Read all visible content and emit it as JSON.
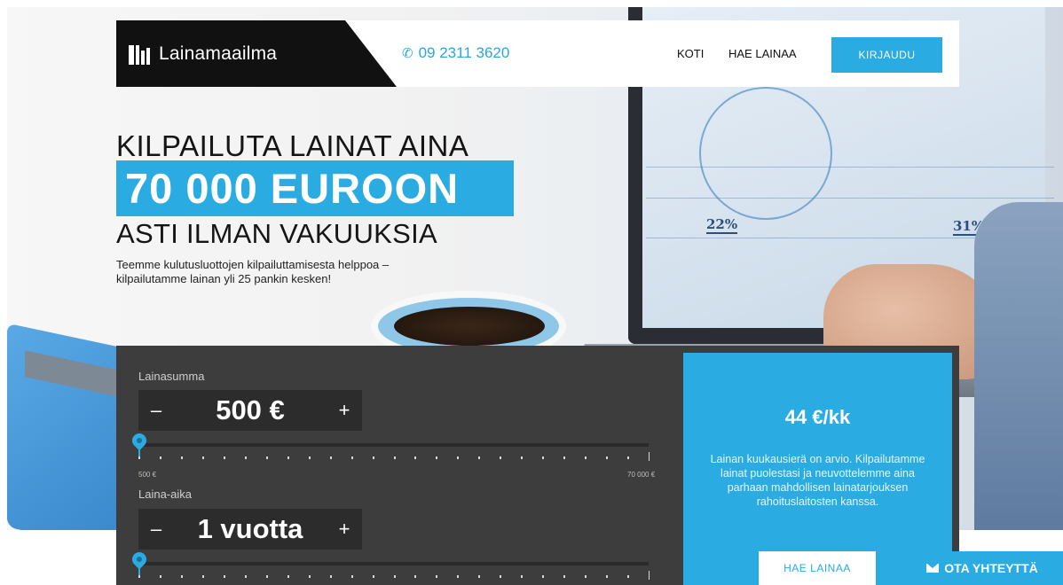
{
  "header": {
    "logo_text": "Lainamaailma",
    "phone": "09 2311 3620",
    "nav": [
      "KOTI",
      "HAE LAINAA"
    ],
    "login_label": "KIRJAUDU"
  },
  "hero": {
    "line1": "KILPAILUTA LAINAT AINA",
    "amount": "70 000 EUROON",
    "line3": "ASTI ILMAN VAKUUKSIA",
    "sub_line1": "Teemme kulutusluottojen kilpailuttamisesta helppoa –",
    "sub_line2": "kilpailutamme lainan yli 25 pankin kesken!",
    "chart_labels": [
      "22%",
      "31%"
    ]
  },
  "calculator": {
    "amount_label": "Lainasumma",
    "amount_value": "500 €",
    "amount_min": "500 €",
    "amount_max": "70 000 €",
    "amount_slider_fraction": 0,
    "term_label": "Laina-aika",
    "term_value": "1 vuotta",
    "term_slider_fraction": 0,
    "minus": "–",
    "plus": "+"
  },
  "result": {
    "monthly": "44 €/kk",
    "text": "Lainan kuukausierä on arvio. Kilpailutamme lainat puolestasi ja neuvottelemme aina parhaan mahdollisen lainatarjouksen rahoituslaitosten kanssa.",
    "apply_label": "HAE LAINAA"
  },
  "contact": {
    "label": "OTA YHTEYTTÄ"
  },
  "colors": {
    "accent": "#2aace3",
    "panel": "#3d3d3d",
    "logo_bg": "#111111"
  },
  "icons": {
    "phone": "phone-icon",
    "contact": "mail-icon"
  }
}
